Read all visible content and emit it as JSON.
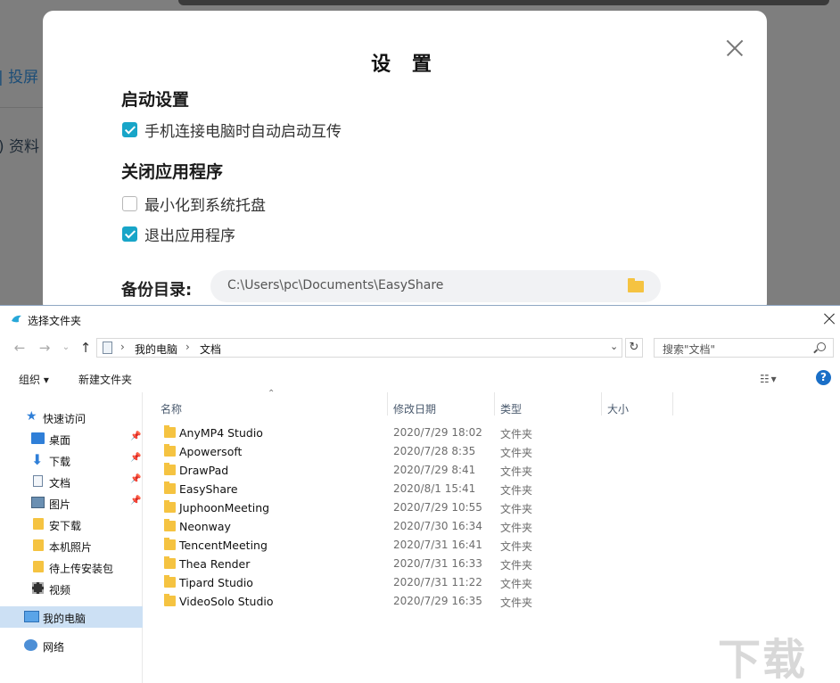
{
  "background": {
    "item_1": "投屏",
    "item_2": "资料"
  },
  "settings": {
    "title": "设 置",
    "startup_section": "启动设置",
    "startup_option": "手机连接电脑时自动启动互传",
    "close_section": "关闭应用程序",
    "close_options": [
      {
        "label": "最小化到系统托盘",
        "checked": false
      },
      {
        "label": "退出应用程序",
        "checked": true
      }
    ],
    "backup_label": "备份目录:",
    "backup_path": "C:\\Users\\pc\\Documents\\EasyShare",
    "accent_color": "#18a5c8"
  },
  "file_dialog": {
    "title": "选择文件夹",
    "breadcrumb": [
      "我的电脑",
      "文档"
    ],
    "search_placeholder": "搜索\"文档\"",
    "toolbar": {
      "organize": "组织 ▾",
      "new_folder": "新建文件夹"
    },
    "nav_tree": [
      {
        "label": "快速访问",
        "icon": "star-icon"
      },
      {
        "label": "桌面",
        "icon": "desktop-icon",
        "pinned": true
      },
      {
        "label": "下载",
        "icon": "download-icon",
        "pinned": true
      },
      {
        "label": "文档",
        "icon": "document-icon",
        "pinned": true
      },
      {
        "label": "图片",
        "icon": "picture-icon",
        "pinned": true
      },
      {
        "label": "安下载",
        "icon": "folder-icon"
      },
      {
        "label": "本机照片",
        "icon": "folder-icon"
      },
      {
        "label": "待上传安装包",
        "icon": "folder-icon"
      },
      {
        "label": "视频",
        "icon": "video-icon"
      },
      {
        "label": "我的电脑",
        "icon": "computer-icon",
        "selected": true
      },
      {
        "label": "网络",
        "icon": "network-icon"
      }
    ],
    "columns": [
      "名称",
      "修改日期",
      "类型",
      "大小"
    ],
    "rows": [
      {
        "name": "AnyMP4 Studio",
        "date": "2020/7/29 18:02",
        "type": "文件夹"
      },
      {
        "name": "Apowersoft",
        "date": "2020/7/28 8:35",
        "type": "文件夹"
      },
      {
        "name": "DrawPad",
        "date": "2020/7/29 8:41",
        "type": "文件夹"
      },
      {
        "name": "EasyShare",
        "date": "2020/8/1 15:41",
        "type": "文件夹"
      },
      {
        "name": "JuphoonMeeting",
        "date": "2020/7/29 10:55",
        "type": "文件夹"
      },
      {
        "name": "Neonway",
        "date": "2020/7/30 16:34",
        "type": "文件夹"
      },
      {
        "name": "TencentMeeting",
        "date": "2020/7/31 16:41",
        "type": "文件夹"
      },
      {
        "name": "Thea Render",
        "date": "2020/7/31 16:33",
        "type": "文件夹"
      },
      {
        "name": "Tipard Studio",
        "date": "2020/7/31 11:22",
        "type": "文件夹"
      },
      {
        "name": "VideoSolo Studio",
        "date": "2020/7/29 16:35",
        "type": "文件夹"
      }
    ]
  },
  "watermark": "下载吧"
}
